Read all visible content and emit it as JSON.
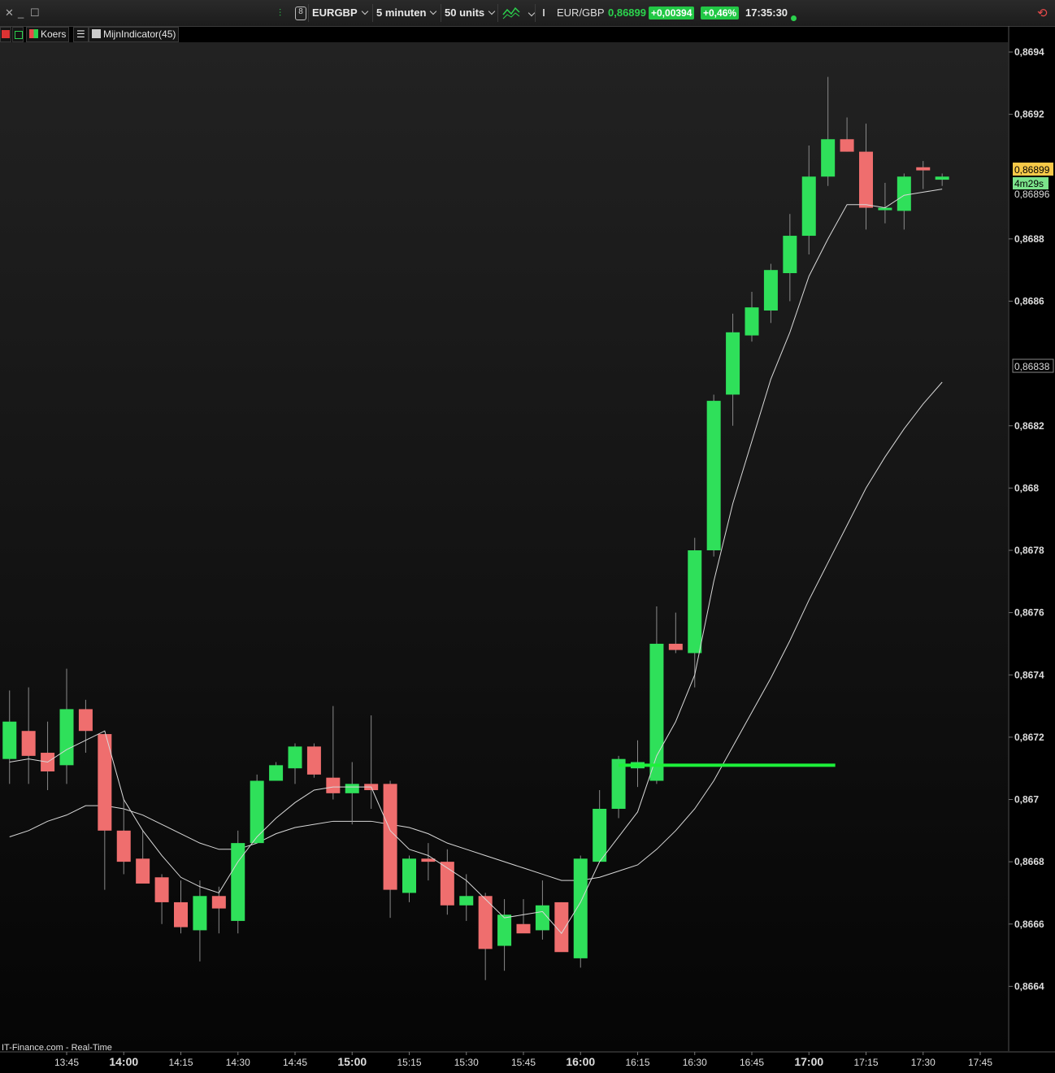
{
  "toolbar": {
    "symbol": "EURGBP",
    "interval": "5 minuten",
    "units": "50 units",
    "quote_name": "EUR/GBP",
    "last_price": "0,86899",
    "change_abs": "+0,00394",
    "change_pct": "+0,46%",
    "time": "17:35:30",
    "status_color": "#2bd24d"
  },
  "legend": {
    "price_label": "Koers",
    "indicator_label": "MijnIndicator(45)"
  },
  "price_tags": {
    "last": "0,86899",
    "countdown": "4m29s",
    "ma_fast": "0,86896",
    "ma_slow": "0,86838"
  },
  "source_label": "IT-Finance.com - Real-Time",
  "colors": {
    "up": "#2fe05a",
    "down": "#ef6e6e",
    "hline": "#1df03a",
    "ma": "#d8d8d8",
    "last_tag": "#f7c948",
    "countdown_tag": "#7be38b"
  },
  "chart_data": {
    "type": "candlestick",
    "interval_minutes": 5,
    "ylim": [
      0.8662,
      0.8695
    ],
    "y_ticks": [
      "0,8664",
      "0,8666",
      "0,8668",
      "0,867",
      "0,8672",
      "0,8674",
      "0,8676",
      "0,8678",
      "0,868",
      "0,8682",
      "0,8686",
      "0,8688",
      "0,8692",
      "0,8694"
    ],
    "x_ticks": [
      {
        "label": "13:45",
        "time": "13:45",
        "bold": false
      },
      {
        "label": "14:00",
        "time": "14:00",
        "bold": true
      },
      {
        "label": "14:15",
        "time": "14:15",
        "bold": false
      },
      {
        "label": "14:30",
        "time": "14:30",
        "bold": false
      },
      {
        "label": "14:45",
        "time": "14:45",
        "bold": false
      },
      {
        "label": "15:00",
        "time": "15:00",
        "bold": true
      },
      {
        "label": "15:15",
        "time": "15:15",
        "bold": false
      },
      {
        "label": "15:30",
        "time": "15:30",
        "bold": false
      },
      {
        "label": "15:45",
        "time": "15:45",
        "bold": false
      },
      {
        "label": "16:00",
        "time": "16:00",
        "bold": true
      },
      {
        "label": "16:15",
        "time": "16:15",
        "bold": false
      },
      {
        "label": "16:30",
        "time": "16:30",
        "bold": false
      },
      {
        "label": "16:45",
        "time": "16:45",
        "bold": false
      },
      {
        "label": "17:00",
        "time": "17:00",
        "bold": true
      },
      {
        "label": "17:15",
        "time": "17:15",
        "bold": false
      },
      {
        "label": "17:30",
        "time": "17:30",
        "bold": false
      },
      {
        "label": "17:45",
        "time": "17:45",
        "bold": false
      }
    ],
    "candles": [
      {
        "t": "13:30",
        "o": 0.86713,
        "h": 0.86735,
        "l": 0.86705,
        "c": 0.86725
      },
      {
        "t": "13:35",
        "o": 0.86722,
        "h": 0.86736,
        "l": 0.86705,
        "c": 0.86714
      },
      {
        "t": "13:40",
        "o": 0.86715,
        "h": 0.86725,
        "l": 0.86703,
        "c": 0.86709
      },
      {
        "t": "13:45",
        "o": 0.86711,
        "h": 0.86742,
        "l": 0.86705,
        "c": 0.86729
      },
      {
        "t": "13:50",
        "o": 0.86729,
        "h": 0.86732,
        "l": 0.86715,
        "c": 0.86722
      },
      {
        "t": "13:55",
        "o": 0.86721,
        "h": 0.8672,
        "l": 0.86671,
        "c": 0.8669
      },
      {
        "t": "14:00",
        "o": 0.8669,
        "h": 0.867,
        "l": 0.86676,
        "c": 0.8668
      },
      {
        "t": "14:05",
        "o": 0.86681,
        "h": 0.8669,
        "l": 0.86674,
        "c": 0.86673
      },
      {
        "t": "14:10",
        "o": 0.86675,
        "h": 0.86676,
        "l": 0.8666,
        "c": 0.86667
      },
      {
        "t": "14:15",
        "o": 0.86667,
        "h": 0.86674,
        "l": 0.86657,
        "c": 0.86659
      },
      {
        "t": "14:20",
        "o": 0.86658,
        "h": 0.86674,
        "l": 0.86648,
        "c": 0.86669
      },
      {
        "t": "14:25",
        "o": 0.86669,
        "h": 0.86672,
        "l": 0.86657,
        "c": 0.86665
      },
      {
        "t": "14:30",
        "o": 0.86661,
        "h": 0.8669,
        "l": 0.86657,
        "c": 0.86686
      },
      {
        "t": "14:35",
        "o": 0.86686,
        "h": 0.86708,
        "l": 0.86686,
        "c": 0.86706
      },
      {
        "t": "14:40",
        "o": 0.86706,
        "h": 0.86712,
        "l": 0.86706,
        "c": 0.86711
      },
      {
        "t": "14:45",
        "o": 0.8671,
        "h": 0.86718,
        "l": 0.86705,
        "c": 0.86717
      },
      {
        "t": "14:50",
        "o": 0.86717,
        "h": 0.86718,
        "l": 0.86707,
        "c": 0.86708
      },
      {
        "t": "14:55",
        "o": 0.86707,
        "h": 0.8673,
        "l": 0.867,
        "c": 0.86702
      },
      {
        "t": "15:00",
        "o": 0.86702,
        "h": 0.86712,
        "l": 0.86692,
        "c": 0.86705
      },
      {
        "t": "15:05",
        "o": 0.86705,
        "h": 0.86727,
        "l": 0.86697,
        "c": 0.86703
      },
      {
        "t": "15:10",
        "o": 0.86705,
        "h": 0.86706,
        "l": 0.86662,
        "c": 0.86671
      },
      {
        "t": "15:15",
        "o": 0.8667,
        "h": 0.86682,
        "l": 0.86667,
        "c": 0.86681
      },
      {
        "t": "15:20",
        "o": 0.86681,
        "h": 0.86686,
        "l": 0.86674,
        "c": 0.8668
      },
      {
        "t": "15:25",
        "o": 0.8668,
        "h": 0.86684,
        "l": 0.86663,
        "c": 0.86666
      },
      {
        "t": "15:30",
        "o": 0.86666,
        "h": 0.86676,
        "l": 0.86661,
        "c": 0.86669
      },
      {
        "t": "15:35",
        "o": 0.86669,
        "h": 0.8667,
        "l": 0.86642,
        "c": 0.86652
      },
      {
        "t": "15:40",
        "o": 0.86653,
        "h": 0.86668,
        "l": 0.86645,
        "c": 0.86663
      },
      {
        "t": "15:45",
        "o": 0.8666,
        "h": 0.86668,
        "l": 0.8666,
        "c": 0.86657
      },
      {
        "t": "15:50",
        "o": 0.86658,
        "h": 0.86674,
        "l": 0.86655,
        "c": 0.86666
      },
      {
        "t": "15:55",
        "o": 0.86667,
        "h": 0.86667,
        "l": 0.86653,
        "c": 0.86651
      },
      {
        "t": "16:00",
        "o": 0.86649,
        "h": 0.86682,
        "l": 0.86646,
        "c": 0.86681
      },
      {
        "t": "16:05",
        "o": 0.8668,
        "h": 0.86703,
        "l": 0.8668,
        "c": 0.86697
      },
      {
        "t": "16:10",
        "o": 0.86697,
        "h": 0.86714,
        "l": 0.86694,
        "c": 0.86713
      },
      {
        "t": "16:15",
        "o": 0.8671,
        "h": 0.86719,
        "l": 0.86704,
        "c": 0.86712
      },
      {
        "t": "16:20",
        "o": 0.86706,
        "h": 0.86762,
        "l": 0.86705,
        "c": 0.8675
      },
      {
        "t": "16:25",
        "o": 0.8675,
        "h": 0.8676,
        "l": 0.86747,
        "c": 0.86748
      },
      {
        "t": "16:30",
        "o": 0.86747,
        "h": 0.86784,
        "l": 0.86736,
        "c": 0.8678
      },
      {
        "t": "16:35",
        "o": 0.8678,
        "h": 0.8683,
        "l": 0.86778,
        "c": 0.86828
      },
      {
        "t": "16:40",
        "o": 0.8683,
        "h": 0.86856,
        "l": 0.8682,
        "c": 0.8685
      },
      {
        "t": "16:45",
        "o": 0.86849,
        "h": 0.86863,
        "l": 0.86847,
        "c": 0.86858
      },
      {
        "t": "16:50",
        "o": 0.86857,
        "h": 0.86872,
        "l": 0.86853,
        "c": 0.8687
      },
      {
        "t": "16:55",
        "o": 0.86869,
        "h": 0.86888,
        "l": 0.8686,
        "c": 0.86881
      },
      {
        "t": "17:00",
        "o": 0.86881,
        "h": 0.8691,
        "l": 0.86875,
        "c": 0.869
      },
      {
        "t": "17:05",
        "o": 0.869,
        "h": 0.86932,
        "l": 0.86897,
        "c": 0.86912
      },
      {
        "t": "17:10",
        "o": 0.86912,
        "h": 0.86919,
        "l": 0.86908,
        "c": 0.86908
      },
      {
        "t": "17:15",
        "o": 0.86908,
        "h": 0.86917,
        "l": 0.86883,
        "c": 0.8689
      },
      {
        "t": "17:20",
        "o": 0.8689,
        "h": 0.86898,
        "l": 0.86885,
        "c": 0.8689
      },
      {
        "t": "17:25",
        "o": 0.86889,
        "h": 0.86901,
        "l": 0.86883,
        "c": 0.869
      },
      {
        "t": "17:30",
        "o": 0.86903,
        "h": 0.86905,
        "l": 0.86896,
        "c": 0.86902
      },
      {
        "t": "17:35",
        "o": 0.86899,
        "h": 0.86901,
        "l": 0.86897,
        "c": 0.869
      }
    ],
    "ma_fast": [
      0.86712,
      0.86713,
      0.86712,
      0.86716,
      0.86719,
      0.86722,
      0.867,
      0.8669,
      0.86682,
      0.86675,
      0.86672,
      0.8667,
      0.8668,
      0.86688,
      0.86694,
      0.86699,
      0.86703,
      0.86704,
      0.86704,
      0.86704,
      0.8669,
      0.86684,
      0.86682,
      0.86678,
      0.86674,
      0.86668,
      0.86662,
      0.86663,
      0.86664,
      0.86657,
      0.86667,
      0.8668,
      0.86688,
      0.86696,
      0.86714,
      0.86725,
      0.8674,
      0.8677,
      0.86795,
      0.86815,
      0.86835,
      0.8685,
      0.86868,
      0.8688,
      0.86891,
      0.86891,
      0.8689,
      0.86894,
      0.86895,
      0.86896
    ],
    "ma_slow": [
      0.86688,
      0.8669,
      0.86693,
      0.86695,
      0.86698,
      0.86698,
      0.86697,
      0.86695,
      0.86692,
      0.86689,
      0.86686,
      0.86684,
      0.86684,
      0.86686,
      0.86689,
      0.86691,
      0.86692,
      0.86693,
      0.86693,
      0.86693,
      0.86692,
      0.86691,
      0.86689,
      0.86686,
      0.86684,
      0.86682,
      0.8668,
      0.86678,
      0.86676,
      0.86674,
      0.86674,
      0.86675,
      0.86677,
      0.86679,
      0.86684,
      0.8669,
      0.86697,
      0.86706,
      0.86717,
      0.86728,
      0.86739,
      0.86751,
      0.86764,
      0.86776,
      0.86788,
      0.868,
      0.8681,
      0.86819,
      0.86827,
      0.86834
    ],
    "hline": {
      "value": 0.86711,
      "from": "16:10",
      "to": "17:05"
    }
  }
}
